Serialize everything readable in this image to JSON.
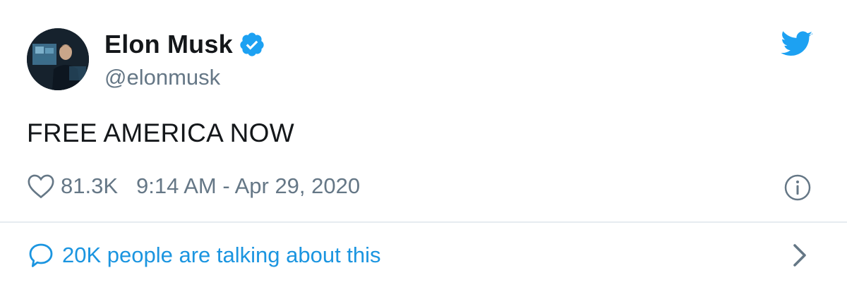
{
  "user": {
    "display_name": "Elon Musk",
    "handle": "@elonmusk",
    "verified": true,
    "avatar_icon": "profile-photo"
  },
  "tweet": {
    "text": "FREE AMERICA NOW",
    "likes": "81.3K",
    "timestamp": "9:14 AM - Apr 29, 2020"
  },
  "footer": {
    "talking_text": "20K people are talking about this"
  },
  "icons": {
    "brand": "twitter-bird-icon",
    "verified": "verified-badge-icon",
    "like": "heart-icon",
    "info": "info-icon",
    "reply": "speech-bubble-icon",
    "next": "chevron-right-icon"
  },
  "colors": {
    "brand_blue": "#1da1f2",
    "link_blue": "#1b95e0",
    "text_primary": "#14171a",
    "text_secondary": "#657786",
    "divider": "#e6ecf0"
  }
}
